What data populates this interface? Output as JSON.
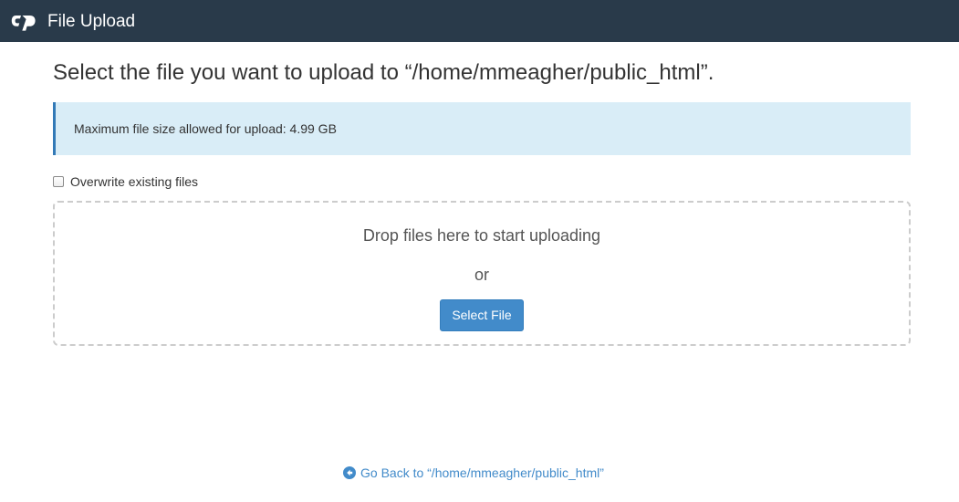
{
  "header": {
    "title": "File Upload",
    "logo_icon": "cpanel-logo-icon"
  },
  "heading": "Select the file you want to upload to “/home/mmeagher/public_html”.",
  "info": {
    "text": "Maximum file size allowed for upload: 4.99 GB"
  },
  "overwrite": {
    "label": "Overwrite existing files",
    "checked": false
  },
  "dropzone": {
    "drop_text": "Drop files here to start uploading",
    "or_text": "or",
    "button_label": "Select File"
  },
  "footer": {
    "go_back_label": "Go Back to “/home/mmeagher/public_html”",
    "go_back_icon": "arrow-circle-left-icon"
  },
  "colors": {
    "topbar": "#293a4a",
    "info_bg": "#d9edf7",
    "accent": "#428bca"
  }
}
